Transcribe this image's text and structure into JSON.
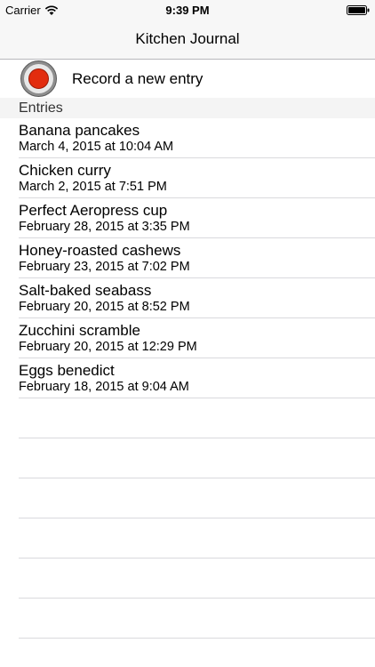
{
  "status_bar": {
    "carrier": "Carrier",
    "time": "9:39 PM",
    "icons": [
      "wifi-icon",
      "battery-icon"
    ]
  },
  "nav": {
    "title": "Kitchen Journal"
  },
  "record": {
    "label": "Record a new entry",
    "icon": "record-icon",
    "accent_color": "#e22c0e"
  },
  "section": {
    "header": "Entries"
  },
  "entries": [
    {
      "title": "Banana pancakes",
      "date": "March 4, 2015 at 10:04 AM"
    },
    {
      "title": "Chicken curry",
      "date": "March 2, 2015 at 7:51 PM"
    },
    {
      "title": "Perfect Aeropress cup",
      "date": "February 28, 2015 at 3:35 PM"
    },
    {
      "title": "Honey-roasted cashews",
      "date": "February 23, 2015 at 7:02 PM"
    },
    {
      "title": "Salt-baked seabass",
      "date": "February 20, 2015 at 8:52 PM"
    },
    {
      "title": "Zucchini scramble",
      "date": "February 20, 2015 at 12:29 PM"
    },
    {
      "title": "Eggs benedict",
      "date": "February 18, 2015 at 9:04 AM"
    }
  ]
}
